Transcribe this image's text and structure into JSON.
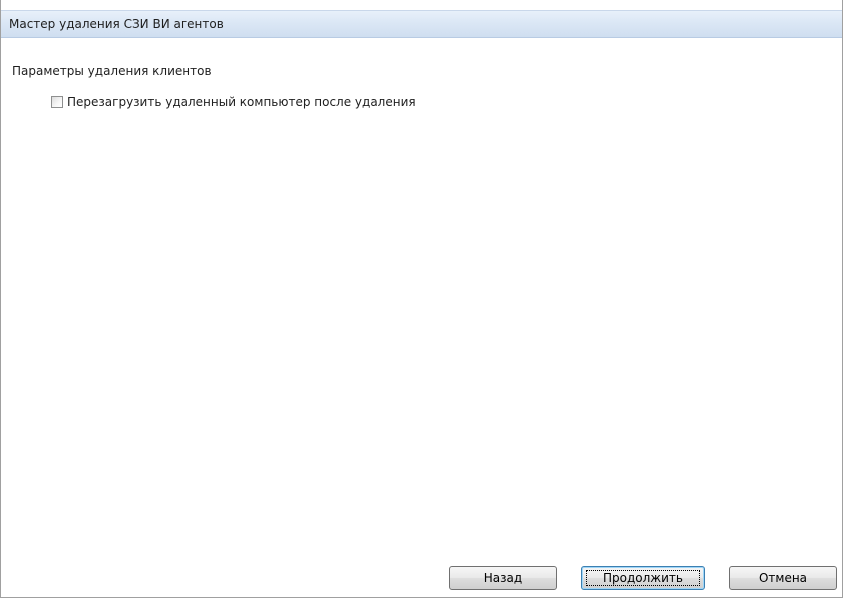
{
  "window": {
    "title": "Мастер удаления СЗИ ВИ агентов"
  },
  "page": {
    "section_title": "Параметры удаления клиентов",
    "options": [
      {
        "label": "Перезагрузить удаленный компьютер после удаления",
        "checked": false
      }
    ]
  },
  "buttons": {
    "back_label": "Назад",
    "next_label": "Продолжить",
    "cancel_label": "Отмена"
  },
  "colors": {
    "titlebar": "#dbe7f5",
    "default_button_border": "#3c7fb1"
  }
}
